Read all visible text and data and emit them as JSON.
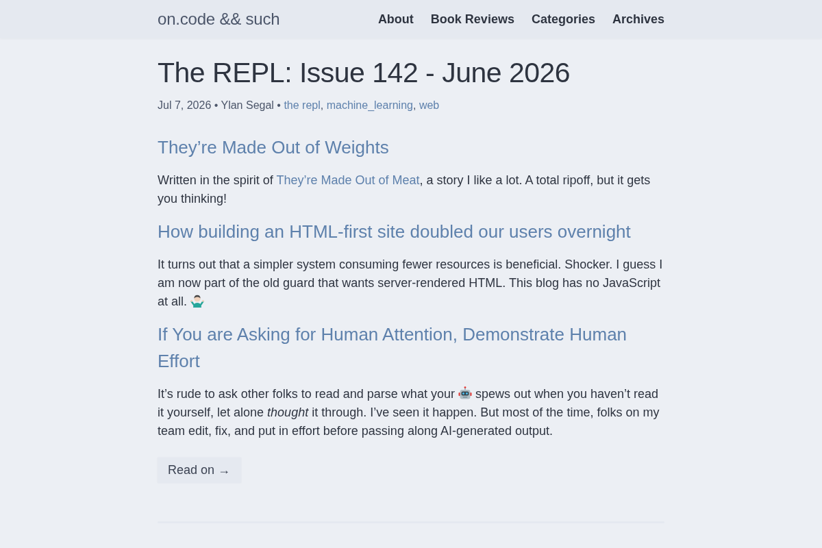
{
  "header": {
    "site_title": "on.code && such",
    "nav": [
      "About",
      "Book Reviews",
      "Categories",
      "Archives"
    ]
  },
  "post": {
    "title": "The REPL: Issue 142 - June 2026",
    "meta": {
      "byline": "Jul 7, 2026 • Ylan Segal •",
      "tags": [
        {
          "label": "the repl",
          "separator": ","
        },
        {
          "label": "machine_learning",
          "separator": ","
        },
        {
          "label": "web"
        }
      ]
    },
    "sections": [
      {
        "heading": "They’re Made Out of Weights",
        "body": [
          {
            "kind": "text",
            "text": "Written in the spirit of "
          },
          {
            "kind": "link",
            "text": "They’re Made Out of Meat"
          },
          {
            "kind": "text",
            "text": ", a story I like a lot. A total ripoff, but it gets you thinking!"
          }
        ]
      },
      {
        "heading": "How building an HTML-first site doubled our users overnight",
        "body": [
          {
            "kind": "text",
            "text": "It turns out that a simpler system consuming fewer resources is beneficial. Shocker. I guess I am now part of the old guard that wants server-rendered HTML. This blog has no JavaScript at all. "
          },
          {
            "kind": "shrug"
          }
        ]
      },
      {
        "heading": "If You are Asking for Human Attention, Demonstrate Human Effort",
        "body": [
          {
            "kind": "text",
            "text": "It’s rude to ask other folks to read and parse what your "
          },
          {
            "kind": "robot"
          },
          {
            "kind": "text",
            "text": " spews out when you haven’t read it yourself, let alone *thought* it through. I’ve seen it happen. But most of the time, folks on my team edit, fix, and put in effort before passing along AI-generated output."
          }
        ]
      }
    ],
    "read_more": "Read on →"
  }
}
